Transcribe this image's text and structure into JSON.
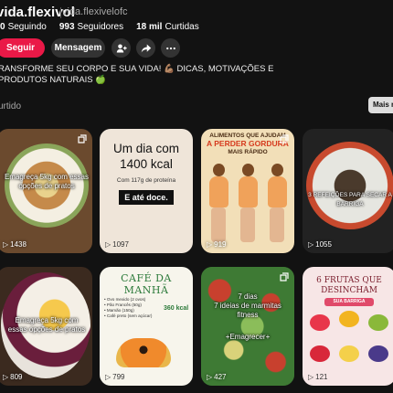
{
  "profile": {
    "name": "vida.flexivol",
    "handle": "vida.flexivelofc",
    "stats": [
      {
        "value": "0",
        "label": "Seguindo"
      },
      {
        "value": "993",
        "label": "Seguidores"
      },
      {
        "value": "18 mil",
        "label": "Curtidas"
      }
    ],
    "follow_label": "Seguir",
    "message_label": "Mensagem",
    "bio": "RANSFORME SEU CORPO E SUA VIDA! 💪🏽 DICAS, MOTIVAÇÕES E PRODUTOS NATURAIS 🍏"
  },
  "tabs": {
    "active": "urtido",
    "more_label": "Mais r"
  },
  "pins": [
    {
      "views": "1438",
      "overlay": "Emagreça 5kg com essas opções de pratos"
    },
    {
      "views": "1097",
      "headline": "Um dia com 1400 kcal",
      "subline": "Com 117g de proteína",
      "tag": "E até doce."
    },
    {
      "views": "919",
      "headline_top": "ALIMENTOS QUE AJUDAM",
      "headline_mid": "A PERDER GORDURA",
      "headline_bot": "MAIS RÁPIDO"
    },
    {
      "views": "1055",
      "overlay": "3 REFEIÇÕES PARA SECAR A BARRIGA"
    },
    {
      "views": "809",
      "overlay": "Emagreça 5kg com essas opções de pratos"
    },
    {
      "views": "799",
      "title": "CAFÉ DA MANHÃ",
      "items": [
        "Ovo mexido (2 ovos)",
        "Pão Francês (50g)",
        "Mamão (150g)",
        "Café preto (sem açúcar)"
      ],
      "kcal": "360 kcal"
    },
    {
      "views": "427",
      "overlay_top": "7 dias",
      "overlay_mid": "7 ideias de marmitas fitness",
      "overlay_bot": "+Emagrecer+"
    },
    {
      "views": "121",
      "title": "6 FRUTAS QUE DESINCHAM",
      "subtitle": "SUA BARRIGA"
    }
  ],
  "colors": {
    "background": "#121212",
    "follow_button": "#ea1947",
    "secondary_button": "#333333"
  }
}
